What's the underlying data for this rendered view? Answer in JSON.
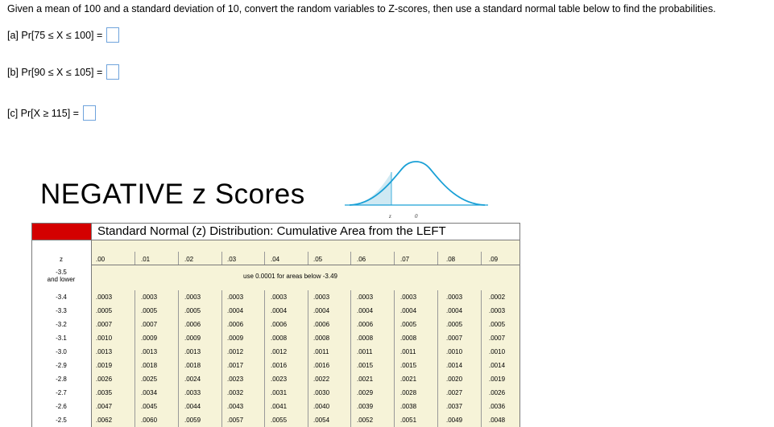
{
  "instructions": "Given a mean of 100 and a standard deviation of 10, convert the random variables to Z-scores, then use a standard normal table below to find the probabilities.",
  "questions": [
    {
      "label": "[a] Pr[75 ≤ X ≤ 100] =",
      "value": ""
    },
    {
      "label": "[b] Pr[90 ≤ X ≤ 105] =",
      "value": ""
    },
    {
      "label": "[c] Pr[X ≥ 115] =",
      "value": ""
    }
  ],
  "title": "NEGATIVE z Scores",
  "curve_labels": {
    "z": "z",
    "zero": "0"
  },
  "table": {
    "header": "Standard Normal (z) Distribution:  Cumulative Area from the LEFT",
    "z_header": "z",
    "columns": [
      ".00",
      ".01",
      ".02",
      ".03",
      ".04",
      ".05",
      ".06",
      ".07",
      ".08",
      ".09"
    ],
    "first_row_label": [
      "-3.5",
      "and lower"
    ],
    "first_row_note": "use 0.0001 for areas below -3.49",
    "rows": [
      {
        "z": "-3.4",
        "values": [
          ".0003",
          ".0003",
          ".0003",
          ".0003",
          ".0003",
          ".0003",
          ".0003",
          ".0003",
          ".0003",
          ".0002"
        ]
      },
      {
        "z": "-3.3",
        "values": [
          ".0005",
          ".0005",
          ".0005",
          ".0004",
          ".0004",
          ".0004",
          ".0004",
          ".0004",
          ".0004",
          ".0003"
        ]
      },
      {
        "z": "-3.2",
        "values": [
          ".0007",
          ".0007",
          ".0006",
          ".0006",
          ".0006",
          ".0006",
          ".0006",
          ".0005",
          ".0005",
          ".0005"
        ]
      },
      {
        "z": "-3.1",
        "values": [
          ".0010",
          ".0009",
          ".0009",
          ".0009",
          ".0008",
          ".0008",
          ".0008",
          ".0008",
          ".0007",
          ".0007"
        ]
      },
      {
        "z": "-3.0",
        "values": [
          ".0013",
          ".0013",
          ".0013",
          ".0012",
          ".0012",
          ".0011",
          ".0011",
          ".0011",
          ".0010",
          ".0010"
        ]
      },
      {
        "z": "-2.9",
        "values": [
          ".0019",
          ".0018",
          ".0018",
          ".0017",
          ".0016",
          ".0016",
          ".0015",
          ".0015",
          ".0014",
          ".0014"
        ]
      },
      {
        "z": "-2.8",
        "values": [
          ".0026",
          ".0025",
          ".0024",
          ".0023",
          ".0023",
          ".0022",
          ".0021",
          ".0021",
          ".0020",
          ".0019"
        ]
      },
      {
        "z": "-2.7",
        "values": [
          ".0035",
          ".0034",
          ".0033",
          ".0032",
          ".0031",
          ".0030",
          ".0029",
          ".0028",
          ".0027",
          ".0026"
        ]
      },
      {
        "z": "-2.6",
        "values": [
          ".0047",
          ".0045",
          ".0044",
          ".0043",
          ".0041",
          ".0040",
          ".0039",
          ".0038",
          ".0037",
          ".0036"
        ]
      },
      {
        "z": "-2.5",
        "values": [
          ".0062",
          ".0060",
          ".0059",
          ".0057",
          ".0055",
          ".0054",
          ".0052",
          ".0051",
          ".0049",
          ".0048"
        ]
      }
    ]
  }
}
